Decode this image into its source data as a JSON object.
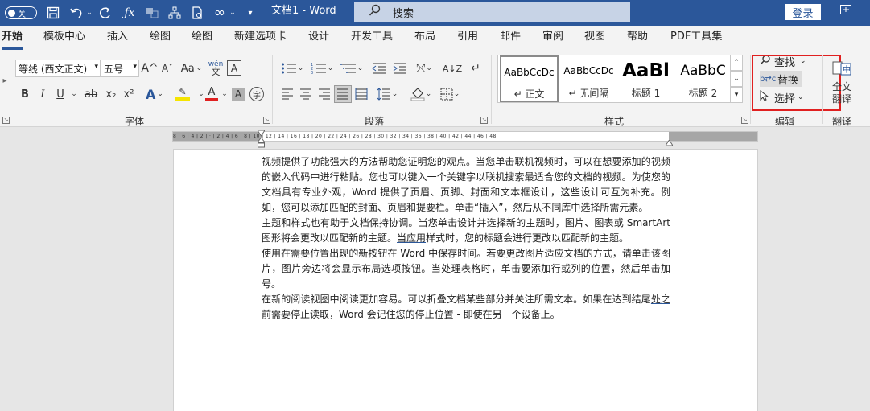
{
  "titlebar": {
    "autosave_label": "关",
    "doc_title": "文档1 - Word",
    "search_placeholder": "搜索",
    "login_label": "登录",
    "icons": [
      "save-icon",
      "undo-icon",
      "redo-icon",
      "fx-icon",
      "sitemap-icon",
      "document-icon",
      "infinity-icon"
    ]
  },
  "tabs": [
    "开始",
    "模板中心",
    "插入",
    "绘图",
    "绘图",
    "新建选项卡",
    "设计",
    "开发工具",
    "布局",
    "引用",
    "邮件",
    "审阅",
    "视图",
    "帮助",
    "PDF工具集"
  ],
  "active_tab": "开始",
  "ribbon": {
    "font_group": {
      "label": "字体",
      "font_name": "等线 (西文正文)",
      "font_size": "五号",
      "grow_label": "A^",
      "shrink_label": "Aˇ",
      "case_label": "Aa",
      "phonetic_label": "wén",
      "border_char_label": "A",
      "bold_label": "B",
      "italic_label": "I",
      "underline_label": "U",
      "strike_label": "ab",
      "subscript_label": "x₂",
      "superscript_label": "x²",
      "effects_label": "A",
      "highlight_label": "ab",
      "font_color_label": "A",
      "char_shading_label": "A",
      "enclose_label": "字",
      "highlight_color": "#f5e400",
      "font_color": "#e02020"
    },
    "paragraph_group": {
      "label": "段落"
    },
    "styles_group": {
      "label": "样式",
      "tiles": [
        {
          "preview": "AaBbCcDc",
          "name": "↵ 正文"
        },
        {
          "preview": "AaBbCcDc",
          "name": "↵ 无间隔"
        },
        {
          "preview": "AaBl",
          "name": "标题 1"
        },
        {
          "preview": "AaBbC",
          "name": "标题 2"
        }
      ]
    },
    "edit_group": {
      "label": "编辑",
      "find_label": "查找",
      "replace_label": "替换",
      "select_label": "选择"
    },
    "translate_group": {
      "label": "翻译",
      "button_label_1": "全文",
      "button_label_2": "翻译"
    }
  },
  "ruler": {
    "marks": "8 | 6 | 4 | 2 | · | 2 | 4 | 6 | 8 | 10 | 12 | 14 | 16 | 18 | 20 | 22 | 24 | 26 | 28 | 30 | 32 | 34 | 36 | 38 | 40 | 42 | 44 | 46 | 48"
  },
  "document": {
    "p1_a": "视频提供了功能强大的方法帮助",
    "p1_u": "您证明",
    "p1_b": "您的观点。当您单击联机视频时，可以在想要添加的视频的嵌入代码中进行粘贴。您也可以键入一个关键字以联机搜索最适合您的文档的视频。为使您的文档具有专业外观，Word 提供了页眉、页脚、封面和文本框设计，这些设计可互为补充。例如，您可以添加匹配的封面、页眉和提要栏。单击“插入”，然后从不同库中选择所需元素。",
    "p2_a": "主题和样式也有助于文档保持协调。当您单击设计并选择新的主题时，图片、图表或 SmartArt 图形将会更改以匹配新的主题。",
    "p2_u": "当应用",
    "p2_b": "样式时，您的标题会进行更改以匹配新的主题。",
    "p3": "使用在需要位置出现的新按钮在 Word 中保存时间。若要更改图片适应文档的方式，请单击该图片，图片旁边将会显示布局选项按钮。当处理表格时，单击要添加行或列的位置，然后单击加号。",
    "p4_a": "在新的阅读视图中阅读更加容易。可以折叠文档某些部分并关注所需文本。如果在达到结尾",
    "p4_u": "处之前",
    "p4_b": "需要停止读取，Word 会记住您的停止位置 - 即使在另一个设备上。"
  }
}
